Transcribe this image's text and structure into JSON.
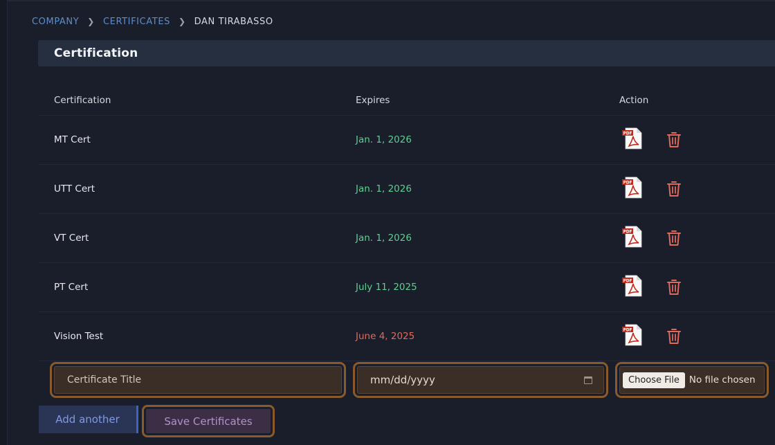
{
  "breadcrumb": {
    "company": "COMPANY",
    "certificates": "CERTIFICATES",
    "current": "DAN TIRABASSO"
  },
  "panel": {
    "title": "Certification"
  },
  "table": {
    "headers": [
      "Certification",
      "Expires",
      "Action"
    ],
    "rows": [
      {
        "name": "MT Cert",
        "expires": "Jan. 1, 2026",
        "status": "valid"
      },
      {
        "name": "UTT Cert",
        "expires": "Jan. 1, 2026",
        "status": "valid"
      },
      {
        "name": "VT Cert",
        "expires": "Jan. 1, 2026",
        "status": "valid"
      },
      {
        "name": "PT Cert",
        "expires": "July 11, 2025",
        "status": "valid"
      },
      {
        "name": "Vision Test",
        "expires": "June 4, 2025",
        "status": "expired"
      }
    ]
  },
  "form": {
    "title_placeholder": "Certificate Title",
    "date_placeholder": "mm/dd/yyyy",
    "choose_file_label": "Choose File",
    "no_file_text": "No file chosen"
  },
  "buttons": {
    "add_another": "Add another",
    "save": "Save Certificates"
  },
  "icons": {
    "breadcrumb_separator": "chevron-right-icon",
    "view": "pdf-icon",
    "delete": "trash-icon",
    "date_picker": "calendar-icon"
  },
  "colors": {
    "valid_date": "#5fcf8f",
    "expired_date": "#e06a5a",
    "delete_icon": "#e06a5a",
    "link": "#5b8ec9"
  }
}
